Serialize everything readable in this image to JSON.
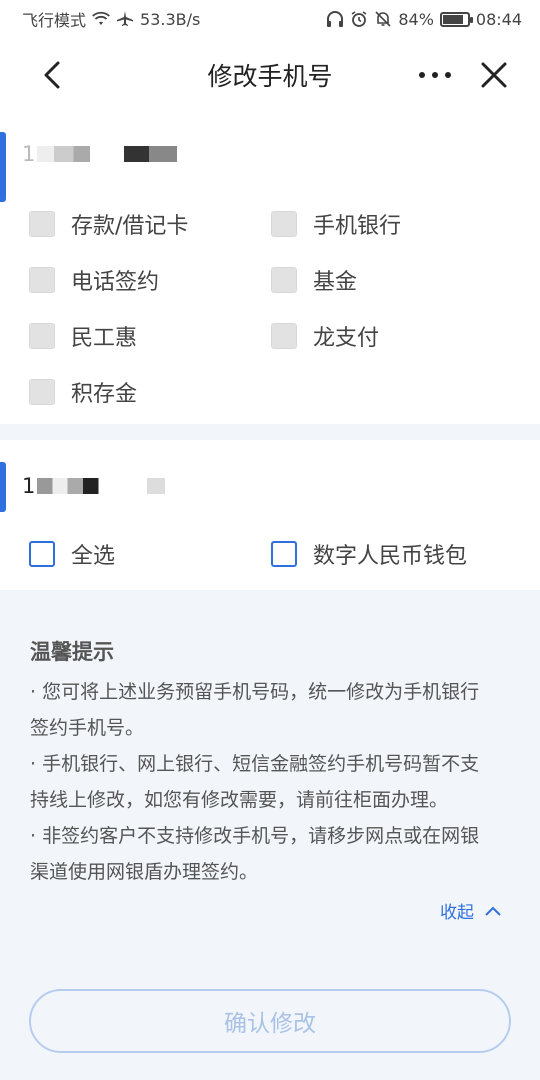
{
  "status_bar": {
    "airplane_mode": "飞行模式",
    "speed": "53.3B/s",
    "battery_percent": "84%",
    "battery_level": 0.84,
    "time": "08:44",
    "icons": [
      "wifi-icon",
      "airplane-icon",
      "headphones-icon",
      "alarm-icon",
      "mute-icon",
      "battery-icon"
    ]
  },
  "nav": {
    "title": "修改手机号",
    "back_icon": "chevron-left-icon",
    "more_icon": "more-dots-icon",
    "close_icon": "close-icon"
  },
  "accounts": [
    {
      "phone_visible": "1",
      "options": [
        {
          "label": "存款/借记卡",
          "state": "disabled"
        },
        {
          "label": "手机银行",
          "state": "disabled"
        },
        {
          "label": "电话签约",
          "state": "disabled"
        },
        {
          "label": "基金",
          "state": "disabled"
        },
        {
          "label": "民工惠",
          "state": "disabled"
        },
        {
          "label": "龙支付",
          "state": "disabled"
        },
        {
          "label": "积存金",
          "state": "disabled"
        }
      ]
    },
    {
      "phone_visible": "1",
      "options": [
        {
          "label": "全选",
          "state": "unchecked"
        },
        {
          "label": "数字人民币钱包",
          "state": "unchecked"
        }
      ]
    }
  ],
  "tips": {
    "title": "温馨提示",
    "lines": [
      "· 您可将上述业务预留手机号码，统一修改为手机银行",
      "签约手机号。",
      "· 手机银行、网上银行、短信金融签约手机号码暂不支",
      "持线上修改，如您有修改需要，请前往柜面办理。",
      "· 非签约客户不支持修改手机号，请移步网点或在网银",
      "渠道使用网银盾办理签约。"
    ],
    "collapse_label": "收起"
  },
  "confirm_button": "确认修改",
  "colors": {
    "accent": "#2f6fde",
    "background": "#f2f6fb",
    "disabled_checkbox": "#e2e2e2",
    "button_disabled_text": "#a9c2e6"
  }
}
